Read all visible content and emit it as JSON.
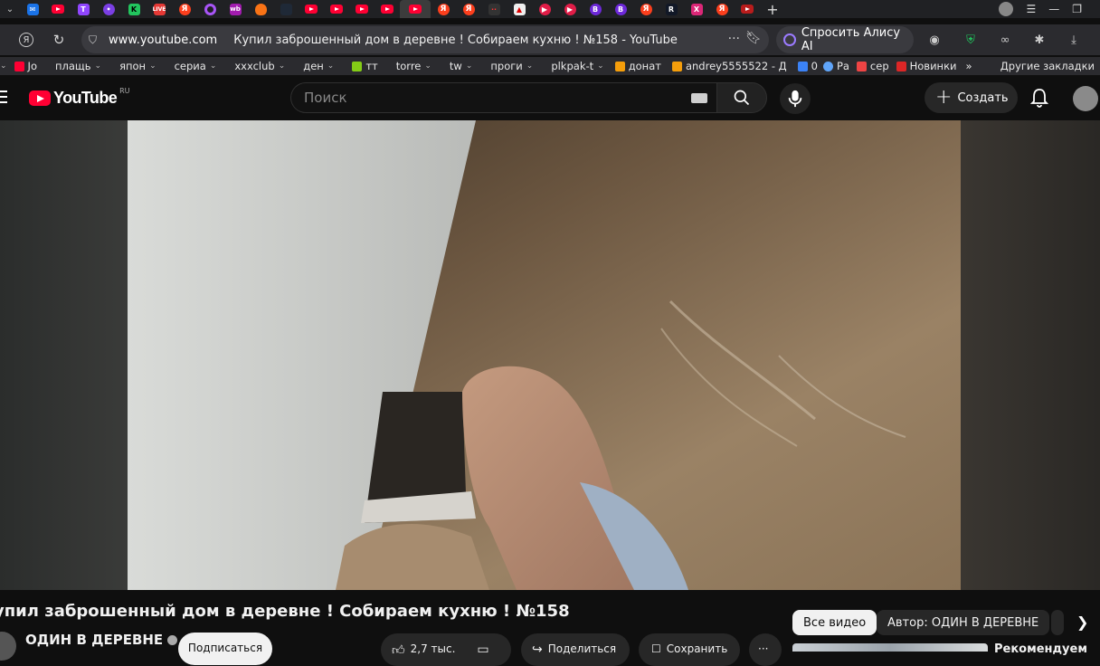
{
  "browser": {
    "tabs": [
      {
        "icon": "dropdown-tab-icon",
        "color": "#5f6368"
      },
      {
        "icon": "mail-tab-icon",
        "color": "#1a73e8"
      },
      {
        "icon": "youtube-tab-icon",
        "color": "#ff0033"
      },
      {
        "icon": "twitch-tab-icon",
        "color": "#9146ff"
      },
      {
        "icon": "music-tab-icon",
        "color": "#7b3fe4"
      },
      {
        "icon": "kinopoisk-tab-icon",
        "color": "#22c55e"
      },
      {
        "icon": "live-tab-icon",
        "color": "#e53935"
      },
      {
        "icon": "yandex-tab-icon",
        "color": "#fc3f1d"
      },
      {
        "icon": "ring-tab-icon",
        "color": "#8b5cf6"
      },
      {
        "icon": "wildberries-tab-icon",
        "color": "#a21caf"
      },
      {
        "icon": "fire-tab-icon",
        "color": "#f97316"
      },
      {
        "icon": "dark-tab-icon",
        "color": "#1f2937"
      },
      {
        "icon": "youtube-tab-icon",
        "color": "#ff0033"
      },
      {
        "icon": "youtube-tab-icon",
        "color": "#ff0033"
      },
      {
        "icon": "youtube-tab-icon",
        "color": "#ff0033"
      },
      {
        "icon": "youtube-tab-icon",
        "color": "#ff0033"
      },
      {
        "icon": "youtube-tab-icon",
        "color": "#ff0033",
        "active": true
      },
      {
        "icon": "yandex-tab-icon",
        "color": "#fc3f1d"
      },
      {
        "icon": "yandex-tab-icon",
        "color": "#fc3f1d"
      },
      {
        "icon": "dots-tab-icon",
        "color": "#333333"
      },
      {
        "icon": "image-tab-icon",
        "color": "#eeeeee"
      },
      {
        "icon": "play-tab-icon",
        "color": "#e11d48"
      },
      {
        "icon": "play-tab-icon",
        "color": "#e11d48"
      },
      {
        "icon": "b-tab-icon",
        "color": "#6d28d9"
      },
      {
        "icon": "b-tab-icon",
        "color": "#6d28d9"
      },
      {
        "icon": "yandex-tab-icon",
        "color": "#fc3f1d"
      },
      {
        "icon": "r-tab-icon",
        "color": "#111827"
      },
      {
        "icon": "x-tab-icon",
        "color": "#db2777"
      },
      {
        "icon": "yandex-tab-icon",
        "color": "#fc3f1d"
      },
      {
        "icon": "youtube-tab-icon",
        "color": "#ff0033"
      }
    ],
    "address": {
      "url": "www.youtube.com",
      "page_title": "Купил заброшенный дом в деревне ! Собираем кухню ! №158 - YouTube"
    },
    "alisa_label": "Спросить Алису AI",
    "bookmarks": [
      {
        "label": "Jo",
        "dropdown": false,
        "color": "#ff0033"
      },
      {
        "label": "плащь",
        "dropdown": true
      },
      {
        "label": "япон",
        "dropdown": true
      },
      {
        "label": "сериа",
        "dropdown": true
      },
      {
        "label": "xxxclub",
        "dropdown": true
      },
      {
        "label": "ден",
        "dropdown": true
      },
      {
        "label": "тт",
        "dropdown": false,
        "color": "#84cc16"
      },
      {
        "label": "torre",
        "dropdown": true
      },
      {
        "label": "tw",
        "dropdown": true
      },
      {
        "label": "проги",
        "dropdown": true
      },
      {
        "label": "plkpak-t",
        "dropdown": true
      },
      {
        "label": "донат",
        "dropdown": false,
        "color": "#f59e0b"
      },
      {
        "label": "andrey5555522 - Д",
        "dropdown": false,
        "color": "#f59e0b"
      },
      {
        "label": "0",
        "dropdown": false,
        "color": "#3b82f6"
      },
      {
        "label": "Ра",
        "dropdown": false,
        "color": "#60a5fa"
      },
      {
        "label": "сер",
        "dropdown": false,
        "color": "#ef4444"
      },
      {
        "label": "Новинки",
        "dropdown": false,
        "color": "#dc2626"
      }
    ],
    "other_bookmarks": "Другие закладки"
  },
  "youtube": {
    "logo_text": "YouTube",
    "region": "RU",
    "search_placeholder": "Поиск",
    "create_label": "Создать",
    "video": {
      "title": "упил заброшенный дом в деревне ! Собираем кухню ! №158",
      "channel": "ОДИН В ДЕРЕВНЕ",
      "subscribe_label": "Подписаться",
      "likes": "2,7 тыс.",
      "share_label": "Поделиться",
      "save_label": "Сохранить"
    },
    "chips": [
      "Все видео",
      "Автор: ОДИН В ДЕРЕВНЕ"
    ],
    "recommendation_title": "Рекомендуем"
  }
}
